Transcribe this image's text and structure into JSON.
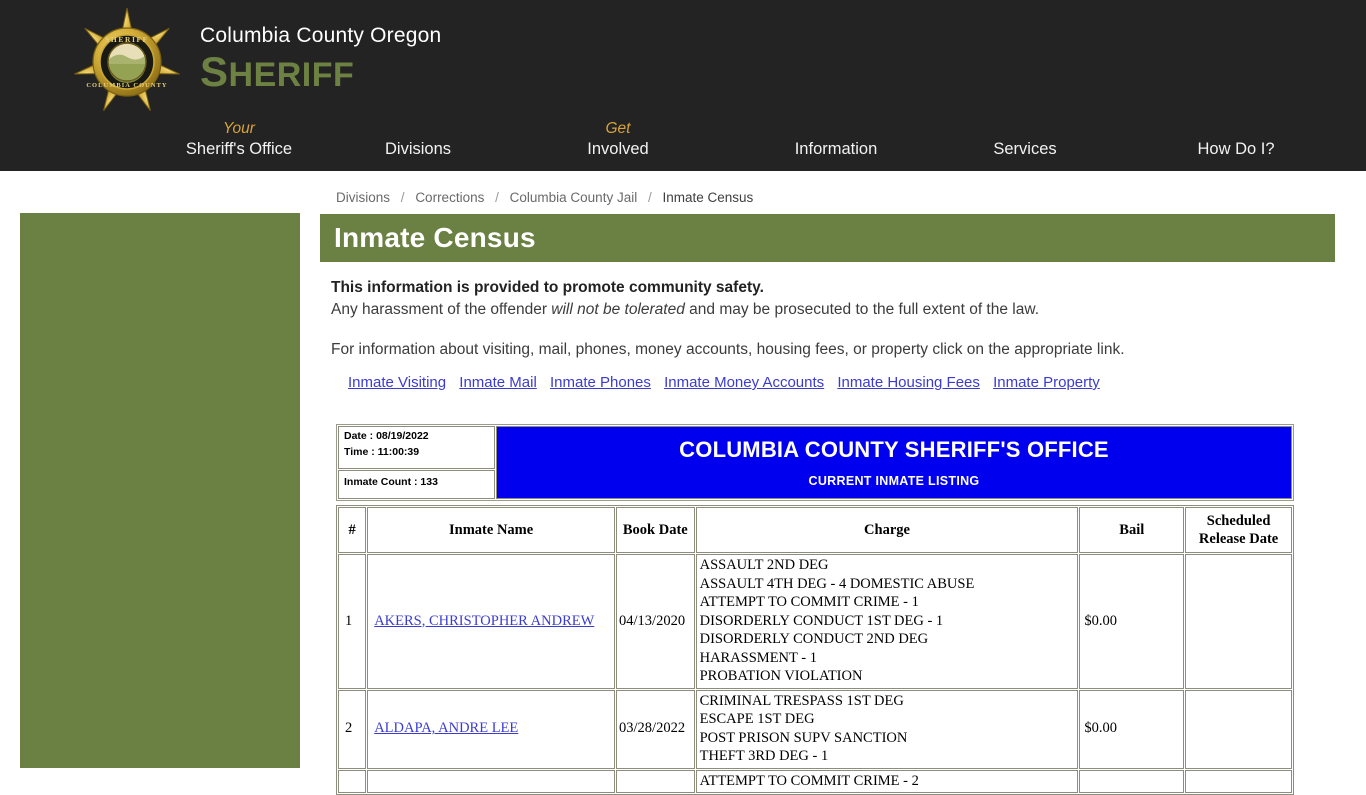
{
  "header": {
    "badge_alt": "Columbia County Sheriff Star Badge",
    "brand_top": "Columbia County Oregon",
    "brand_main_cap": "S",
    "brand_main_rest": "HERIFF",
    "accent_color": "#d8a33c",
    "brand_green": "#6d8142",
    "bg_color": "#232323"
  },
  "nav": {
    "items": [
      {
        "pre": "Your",
        "label": "Sheriff's Office"
      },
      {
        "pre": "",
        "label": "Divisions"
      },
      {
        "pre": "Get",
        "label": "Involved"
      },
      {
        "pre": "",
        "label": "Information"
      },
      {
        "pre": "",
        "label": "Services"
      },
      {
        "pre": "",
        "label": "How Do I?"
      }
    ]
  },
  "breadcrumb": {
    "items": [
      "Divisions",
      "Corrections",
      "Columbia County Jail",
      "Inmate Census"
    ],
    "separator": "/"
  },
  "page": {
    "title": "Inmate Census",
    "title_bar_color": "#6b8043",
    "sidebar_color": "#6b8043"
  },
  "intro": {
    "lead": "This information is provided to promote community safety.",
    "sub_before": "Any harassment of the offender ",
    "sub_italic": "will not be tolerated",
    "sub_after": " and may be prosecuted to the full extent of the law.",
    "para2": "For information about visiting, mail, phones, money accounts, housing fees, or property click on the appropriate link."
  },
  "quick_links": [
    "Inmate Visiting",
    "Inmate Mail",
    "Inmate Phones",
    "Inmate Money Accounts",
    "Inmate Housing Fees",
    "Inmate Property"
  ],
  "report": {
    "date_label": "Date : 08/19/2022",
    "time_label": "Time : 11:00:39",
    "inmate_count_label": "Inmate Count : 133",
    "banner_title": "COLUMBIA COUNTY SHERIFF'S OFFICE",
    "banner_subtitle": "CURRENT INMATE LISTING",
    "banner_color": "#0000ee",
    "columns": [
      "#",
      "Inmate Name",
      "Book Date",
      "Charge",
      "Bail",
      "Scheduled Release Date"
    ],
    "column_release_line1": "Scheduled",
    "column_release_line2": "Release Date",
    "rows": [
      {
        "num": "1",
        "name": "AKERS, CHRISTOPHER ANDREW",
        "book_date": "04/13/2020",
        "charges": [
          "ASSAULT 2ND DEG",
          "ASSAULT 4TH DEG - 4 DOMESTIC ABUSE",
          "ATTEMPT TO COMMIT CRIME - 1",
          "DISORDERLY CONDUCT 1ST DEG - 1",
          "DISORDERLY CONDUCT 2ND DEG",
          "HARASSMENT - 1",
          "PROBATION VIOLATION"
        ],
        "bail": "$0.00",
        "release_date": ""
      },
      {
        "num": "2",
        "name": "ALDAPA, ANDRE LEE",
        "book_date": "03/28/2022",
        "charges": [
          "CRIMINAL TRESPASS 1ST DEG",
          "ESCAPE 1ST DEG",
          "POST PRISON SUPV SANCTION",
          "THEFT 3RD DEG - 1"
        ],
        "bail": "$0.00",
        "release_date": ""
      },
      {
        "num": "",
        "name": "",
        "book_date": "",
        "charges": [
          "ATTEMPT TO COMMIT CRIME - 2"
        ],
        "bail": "",
        "release_date": ""
      }
    ]
  }
}
